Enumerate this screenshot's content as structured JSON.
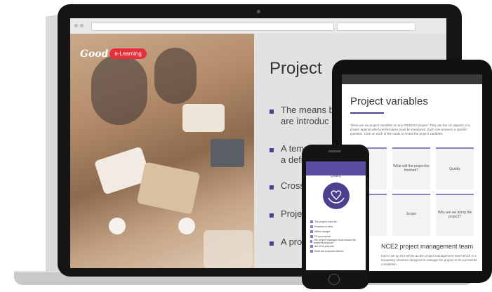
{
  "slide": {
    "title": "Project",
    "bullets": [
      {
        "line1": "The means b",
        "line2": "are introduc"
      },
      {
        "line1": "A temporary",
        "line2": "a defined st"
      },
      {
        "line1": "Cross",
        "line2": ""
      },
      {
        "line1": "Proje",
        "line2": ""
      },
      {
        "line1": "A pro",
        "line2": ""
      }
    ]
  },
  "logo": {
    "word": "Good",
    "pill": "e-Learning"
  },
  "tablet": {
    "title": "Project variables",
    "intro": "There are six project variables on any PRINCE2 project. They are the six aspects of a project against which performance must be measured. Each one answers a specific question. Click on each of the cards to reveal the project variables.",
    "cards": [
      {
        "label": ""
      },
      {
        "label": "What will the project be finished?"
      },
      {
        "label": "Quality"
      },
      {
        "label": ""
      },
      {
        "label": "Scope"
      },
      {
        "label": "Why are we doing the project?"
      }
    ],
    "section_heading": "NCE2 project management team",
    "section_text": "ture is set up at a whole as the project management team which is a temporary structure designed to manage the project to its successful completion."
  },
  "phone": {
    "label": "Quality",
    "items": [
      "The project must be...",
      "Finished on time",
      "Within budget",
      "Fit for purpose",
      "The project manager must ensure the project's products",
      "are fit for purpose",
      "Meet the expected criteria"
    ]
  }
}
